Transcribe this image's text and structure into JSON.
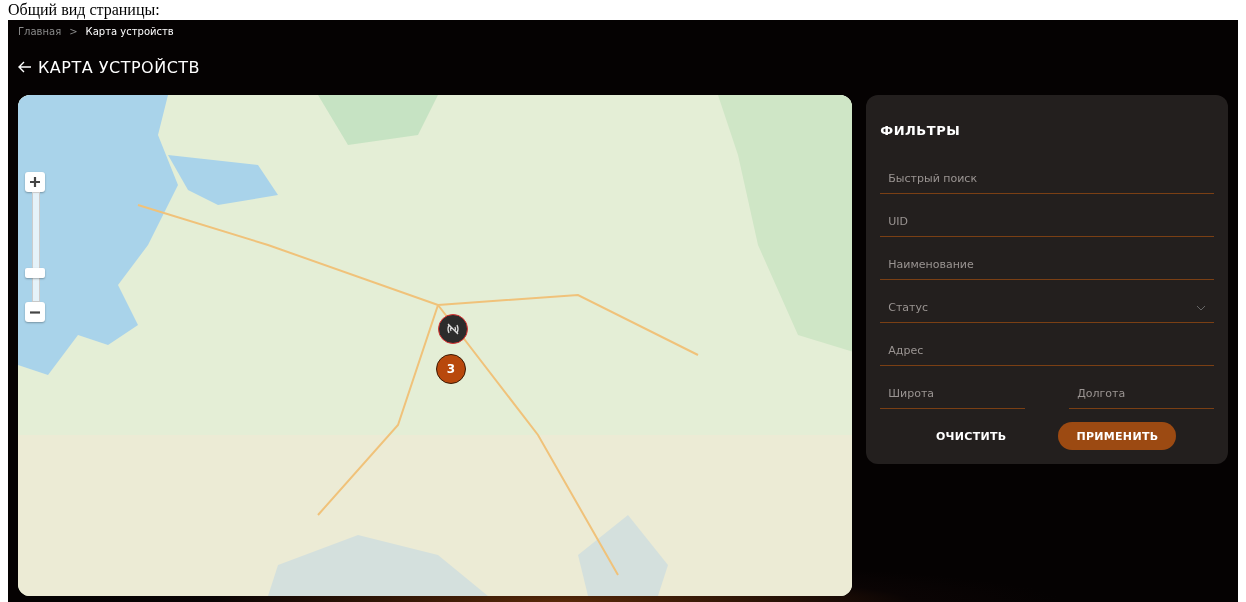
{
  "caption": "Общий вид страницы:",
  "breadcrumb_separator": ">",
  "breadcrumbs": [
    {
      "label": "Главная",
      "current": false
    },
    {
      "label": "Карта устройств",
      "current": true
    }
  ],
  "page_title": "КАРТА УСТРОЙСТВ",
  "map": {
    "zoom": {
      "level": 0.26
    },
    "markers": [
      {
        "kind": "device"
      },
      {
        "kind": "cluster",
        "count": "3"
      }
    ]
  },
  "filters": {
    "title": "ФИЛЬТРЫ",
    "rows": [
      [
        {
          "kind": "text",
          "placeholder": "Быстрый поиск"
        }
      ],
      [
        {
          "kind": "text",
          "placeholder": "UID"
        }
      ],
      [
        {
          "kind": "text",
          "placeholder": "Наименование"
        }
      ],
      [
        {
          "kind": "select",
          "placeholder": "Статус"
        }
      ],
      [
        {
          "kind": "text",
          "placeholder": "Адрес"
        }
      ],
      [
        {
          "kind": "text",
          "placeholder": "Широта"
        },
        {
          "kind": "text",
          "placeholder": "Долгота"
        }
      ]
    ],
    "buttons": [
      {
        "kind": "secondary",
        "label": "ОЧИСТИТЬ"
      },
      {
        "kind": "primary",
        "label": "ПРИМЕНИТЬ"
      }
    ]
  }
}
